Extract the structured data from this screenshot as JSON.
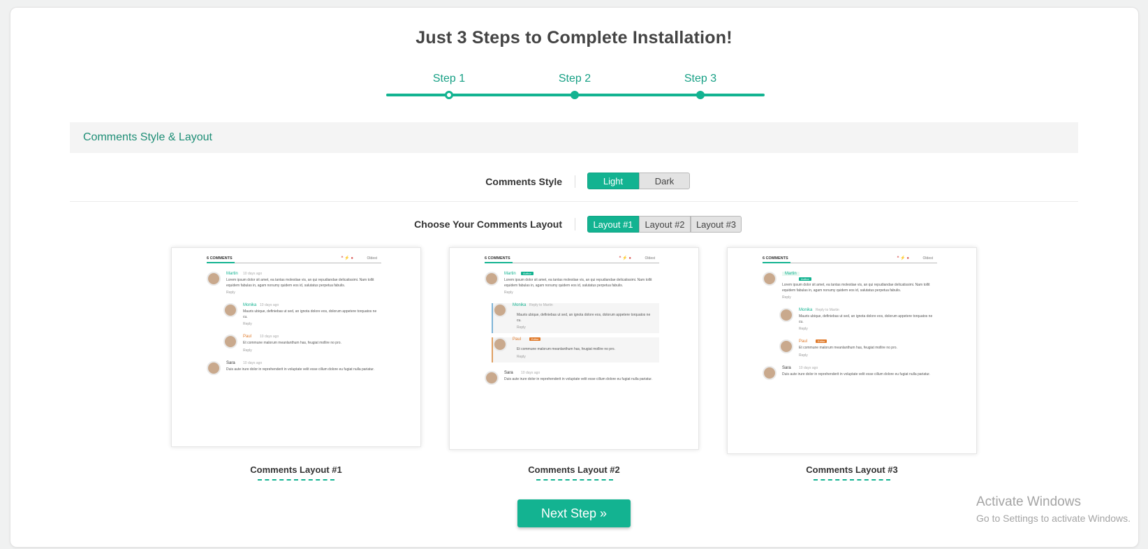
{
  "title": "Just 3 Steps to Complete Installation!",
  "steps": [
    {
      "label": "Step 1",
      "active": true
    },
    {
      "label": "Step 2",
      "active": false
    },
    {
      "label": "Step 3",
      "active": false
    }
  ],
  "section_title": "Comments Style & Layout",
  "style_row": {
    "label": "Comments Style",
    "options": [
      "Light",
      "Dark"
    ],
    "selected": "Light"
  },
  "layout_row": {
    "label": "Choose Your Comments Layout",
    "options": [
      "Layout #1",
      "Layout #2",
      "Layout #3"
    ],
    "selected": "Layout #1"
  },
  "previews": [
    {
      "caption": "Comments Layout #1"
    },
    {
      "caption": "Comments Layout #2"
    },
    {
      "caption": "Comments Layout #3"
    }
  ],
  "mini": {
    "count": "6 COMMENTS",
    "sort": "Oldest",
    "author1": "Martin",
    "author2": "Monika",
    "author3": "Paul",
    "author4": "Sara",
    "time": "10 days ago",
    "reply": "Reply",
    "reply_to": "Reply to Martin",
    "badge_author": "Author",
    "badge_editor": "Editor",
    "text1": "Lorem ipsum dolor sit amet, ea tantas molestiae vis, an qui repudiandae delicatissimi. Nam tollit equidem fabulas in, agam nonumy quidem eos id, salutatus perpetua fabulis.",
    "text2": "Mauris ubique, definiebas ut sed, an ignota dolore eos, dolorum appetere torquatos ne cu.",
    "text3": "Et commune malorum meanlanthum has, feugiat mollire no pro.",
    "text4": "Duis aute irure dolor in reprehenderit in voluptate velit esse cillum dolore eu fugiat nulla pariatur."
  },
  "next_button": "Next Step »",
  "watermark": {
    "line1": "Activate Windows",
    "line2": "Go to Settings to activate Windows."
  },
  "colors": {
    "accent": "#13b391",
    "accent_text": "#17a085"
  }
}
